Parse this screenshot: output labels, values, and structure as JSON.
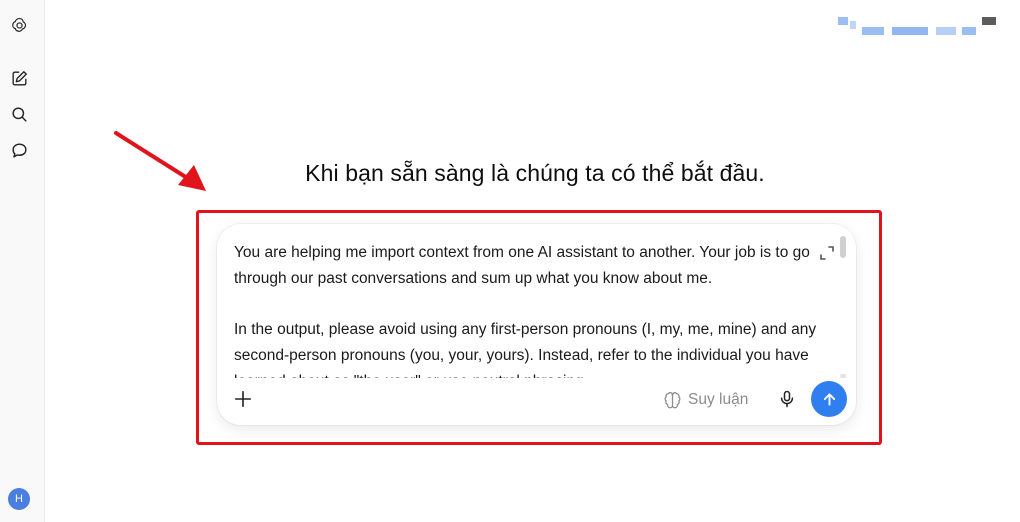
{
  "sidebar": {
    "avatar_initial": "H"
  },
  "main": {
    "greeting": "Khi bạn sẵn sàng là chúng ta có thể bắt đầu."
  },
  "composer": {
    "paragraphs": [
      "You are helping me import context from one AI assistant to another. Your job is to go through our past conversations and sum up what you know about me.",
      "In the output, please avoid using any first-person pronouns (I, my, me, mine) and any second-person pronouns (you, your, yours). Instead, refer to the individual you have learned about as \"the user\" or use neutral phrasing."
    ],
    "reason_label": "Suy luận"
  },
  "colors": {
    "accent": "#2f7ff0",
    "annotation": "#e0141a",
    "avatar": "#4a7fe0"
  }
}
